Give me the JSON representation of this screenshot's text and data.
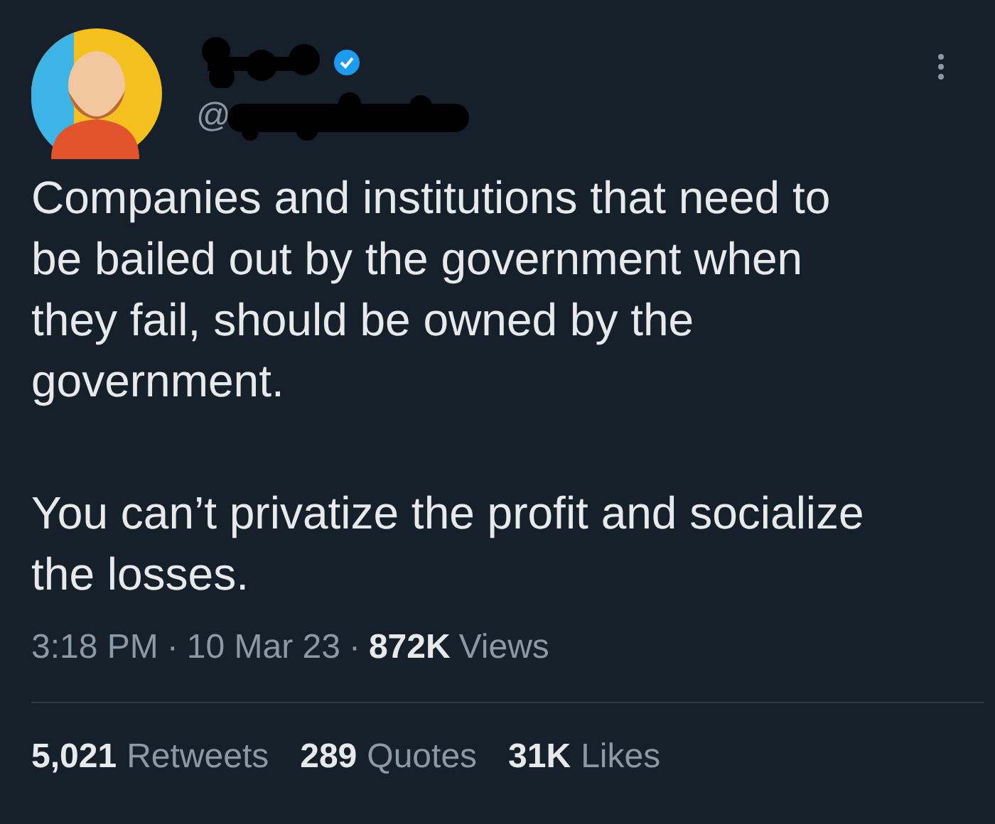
{
  "author": {
    "handle_prefix": "@",
    "verified": true
  },
  "paragraphs": [
    "Companies and institutions that need to be bailed out by the government when they fail, should be owned by the government.",
    "You can’t privatize the profit and socialize the losses."
  ],
  "meta": {
    "time": "3:18 PM",
    "separator_1": "·",
    "date": "10 Mar 23",
    "separator_2": "·",
    "views_count": "872K",
    "views_label": "Views"
  },
  "stats": [
    {
      "count": "5,021",
      "label": "Retweets"
    },
    {
      "count": "289",
      "label": "Quotes"
    },
    {
      "count": "31K",
      "label": "Likes"
    }
  ]
}
